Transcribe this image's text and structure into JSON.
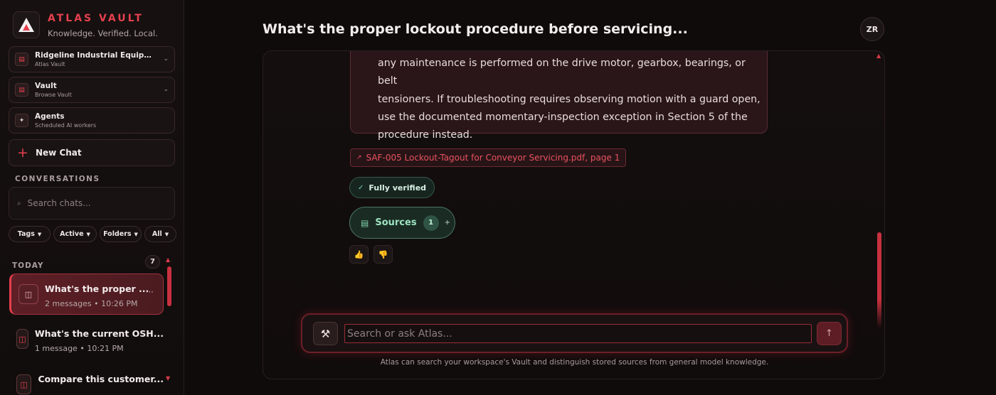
{
  "brand": {
    "title": "ATLAS VAULT",
    "subtitle": "Knowledge. Verified. Local."
  },
  "nav": [
    {
      "title": "Ridgeline Industrial Equipme...",
      "subtitle": "Atlas Vault",
      "icon": "workspace-icon"
    },
    {
      "title": "Vault",
      "subtitle": "Browse Vault",
      "icon": "vault-icon"
    },
    {
      "title": "Agents",
      "subtitle": "Scheduled AI workers",
      "icon": "sparkle-icon"
    }
  ],
  "new_chat_label": "New Chat",
  "conversations_label": "CONVERSATIONS",
  "search_placeholder": "Search chats...",
  "filters": [
    "Tags",
    "Active",
    "Folders",
    "All"
  ],
  "today": {
    "label": "TODAY",
    "count": "7"
  },
  "chats": [
    {
      "title": "What's the proper ...",
      "messages": "2 messages",
      "time": "10:26 PM",
      "active": true
    },
    {
      "title": "What's the current OSH...",
      "messages": "1 message",
      "time": "10:21 PM",
      "active": false
    },
    {
      "title": "Compare this customer...",
      "messages": "",
      "time": "",
      "active": false
    }
  ],
  "chat_meta_separator": "•",
  "header": {
    "title": "What's the proper lockout procedure before servicing...",
    "avatar_initials": "ZR"
  },
  "answer": {
    "lines": [
      "any maintenance is performed on the drive motor, gearbox, bearings, or belt",
      "tensioners. If troubleshooting requires observing motion with a guard open,",
      "use the documented momentary-inspection exception in Section 5 of the",
      "procedure instead."
    ],
    "citation": "SAF-005 Lockout-Tagout for Conveyor Servicing.pdf, page 1",
    "verified_label": "Fully verified",
    "sources_label": "Sources",
    "sources_count": "1"
  },
  "composer": {
    "placeholder": "Search or ask Atlas...",
    "footnote": "Atlas can search your workspace's Vault and distinguish stored sources from general model knowledge."
  },
  "colors": {
    "accent": "#e5404e",
    "verified": "#7fd1a8",
    "background": "#0f0b0b"
  }
}
